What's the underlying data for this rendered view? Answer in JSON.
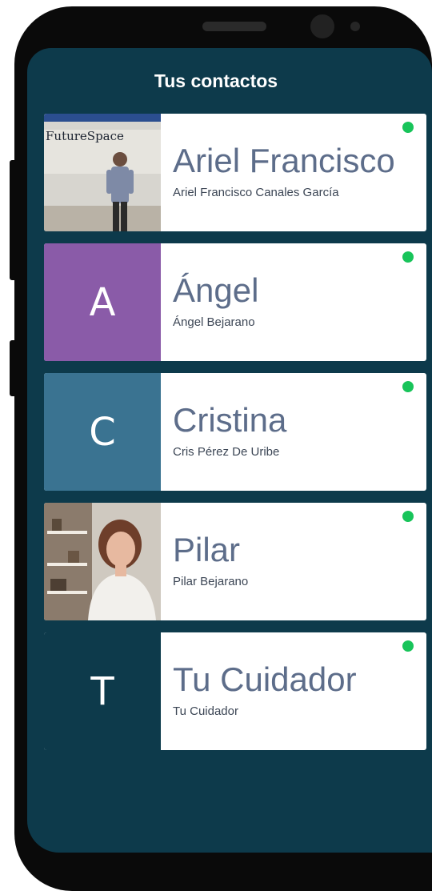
{
  "header": {
    "title": "Tus contactos"
  },
  "contacts": [
    {
      "name": "Ariel Francisco",
      "full_name": "Ariel Francisco Canales García",
      "online": true,
      "avatar": "photo",
      "photo_text": "FutureSpace"
    },
    {
      "name": "Ángel",
      "full_name": "Ángel Bejarano",
      "online": true,
      "avatar": "initial",
      "initial": "A",
      "color": "#8a5ba8"
    },
    {
      "name": "Cristina",
      "full_name": "Cris Pérez De Uribe",
      "online": true,
      "avatar": "initial",
      "initial": "C",
      "color": "#3a7391"
    },
    {
      "name": "Pilar",
      "full_name": "Pilar Bejarano",
      "online": true,
      "avatar": "photo"
    },
    {
      "name": "Tu Cuidador",
      "full_name": "Tu Cuidador",
      "online": true,
      "avatar": "initial",
      "initial": "T",
      "color": "#0d3a4b"
    }
  ],
  "colors": {
    "background": "#0d3a4b",
    "online_dot": "#18c45a",
    "name_text": "#5d6d8a"
  }
}
